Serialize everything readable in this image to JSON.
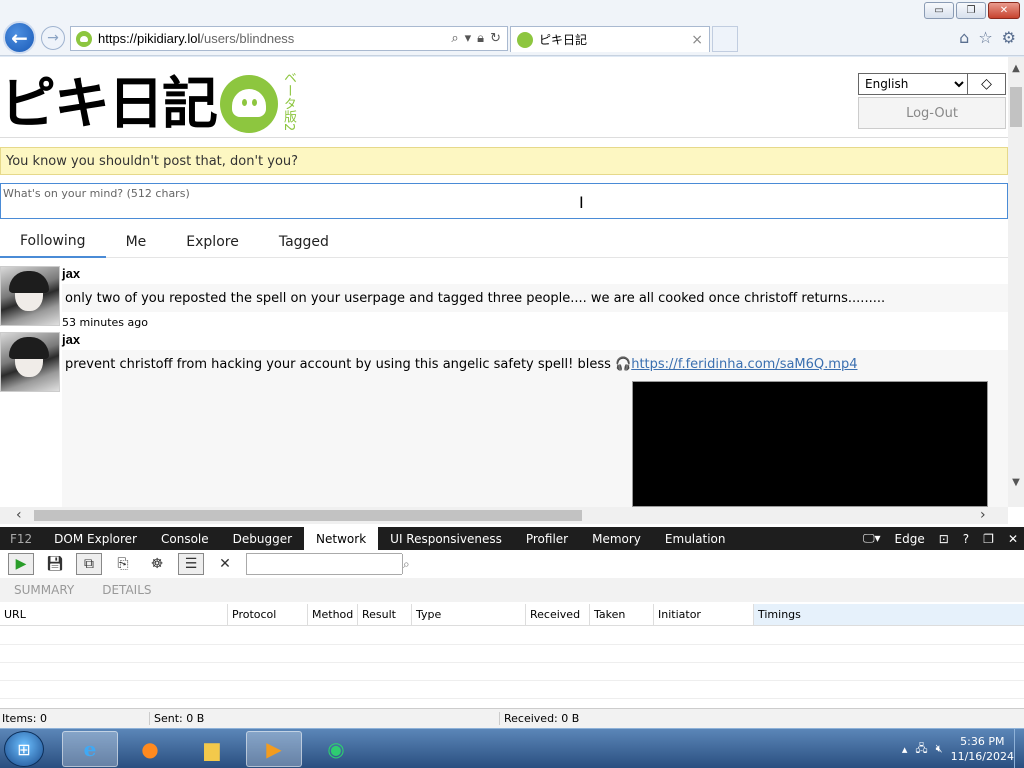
{
  "window": {
    "minimize": "▭",
    "restore": "❐",
    "close": "✕"
  },
  "browser": {
    "url_host": "https://pikidiary.lol",
    "url_path": "/users/blindness",
    "tab_title": "ピキ日記",
    "tab_close": "×"
  },
  "site": {
    "logo_text": "ピキ日記",
    "beta_text": "ベータ版2",
    "language": "English",
    "language_options": [
      "English"
    ],
    "theme_toggle": "◇",
    "logout": "Log-Out",
    "warning": "You know you shouldn't post that, don't you?",
    "compose_placeholder": "What's on your mind? (512 chars)",
    "tabs": [
      "Following",
      "Me",
      "Explore",
      "Tagged"
    ],
    "active_tab": "Following"
  },
  "posts": [
    {
      "user": "jax",
      "body": "only two of you reposted the spell on your userpage and tagged three people.... we are all cooked once christoff returns.........",
      "time": "53 minutes ago"
    },
    {
      "user": "jax",
      "body": "prevent christoff from hacking your account by using this angelic safety spell! bless 🎧 ",
      "link": "https://f.feridinha.com/saM6Q.mp4"
    }
  ],
  "devtools": {
    "f12": "F12",
    "tabs": [
      "DOM Explorer",
      "Console",
      "Debugger",
      "Network",
      "UI Responsiveness",
      "Profiler",
      "Memory",
      "Emulation"
    ],
    "active_tab": "Network",
    "mode": "Edge",
    "subtabs": [
      "SUMMARY",
      "DETAILS"
    ],
    "columns": [
      "URL",
      "Protocol",
      "Method",
      "Result",
      "Type",
      "Received",
      "Taken",
      "Initiator",
      "Timings"
    ],
    "status": {
      "items": "Items: 0",
      "sent": "Sent: 0 B",
      "received": "Received: 0 B"
    }
  },
  "taskbar": {
    "time": "5:36 PM",
    "date": "11/16/2024"
  }
}
